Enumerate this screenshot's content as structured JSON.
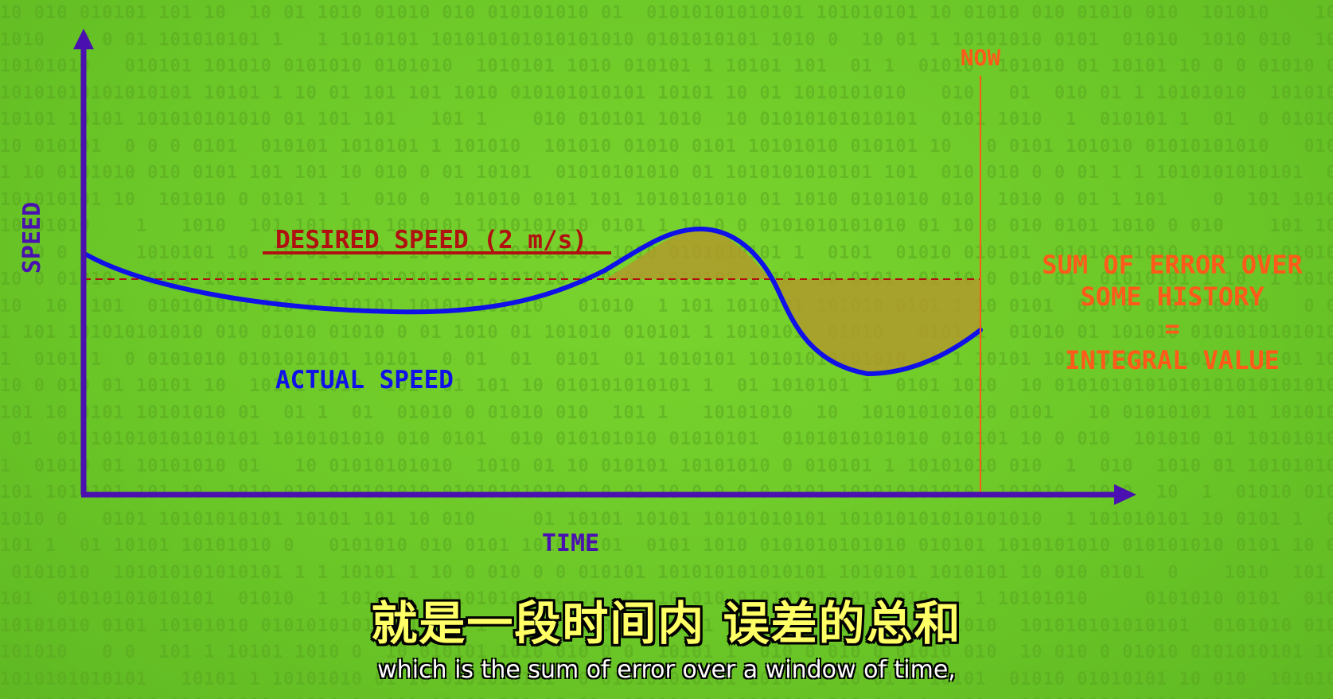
{
  "diagram": {
    "y_axis_label": "SPEED",
    "x_axis_label": "TIME",
    "desired_label": "DESIRED SPEED (2 m/s)",
    "actual_label": "ACTUAL SPEED",
    "now_label": "NOW",
    "error_note": {
      "line1": "SUM OF ERROR OVER",
      "line2": "SOME HISTORY",
      "line3": "=",
      "line4": "INTEGRAL VALUE"
    }
  },
  "subtitles": {
    "zh": "就是一段时间内 误差的总和",
    "en": "which is the sum of error over a window of time,"
  },
  "colors": {
    "axis": "#4a10b0",
    "actual": "#1010e8",
    "desired": "#b01010",
    "now": "#ff5a1a",
    "fill": "#b09a2c"
  }
}
